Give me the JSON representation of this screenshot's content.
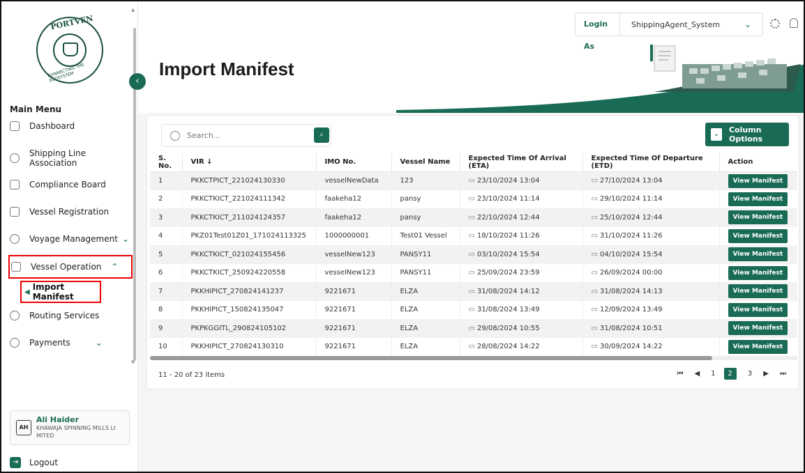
{
  "app": {
    "logo_top": "PORTVEN",
    "logo_bottom": "CONNECTING THE ECOSYSTEM"
  },
  "header": {
    "login_label": "Login As",
    "login_value": "ShippingAgent_System"
  },
  "page": {
    "title": "Import Manifest"
  },
  "sidebar": {
    "menu_title": "Main Menu",
    "items": [
      {
        "label": "Dashboard",
        "icon": "dashboard-icon"
      },
      {
        "label": "Shipping Line Association",
        "icon": "compass-icon"
      },
      {
        "label": "Compliance Board",
        "icon": "document-icon"
      },
      {
        "label": "Vessel Registration",
        "icon": "ship-icon"
      },
      {
        "label": "Voyage Management",
        "icon": "globe-icon",
        "chevron": "⌄"
      },
      {
        "label": "Vessel Operation",
        "icon": "vessel-icon",
        "chevron": "⌃"
      },
      {
        "label": "Routing Services",
        "icon": "route-icon"
      },
      {
        "label": "Payments",
        "icon": "payment-icon",
        "chevron": "⌄"
      }
    ],
    "submenu_active": "Import Manifest",
    "user": {
      "initials": "AH",
      "name": "Ali Haider",
      "org": "KHAWAJA SPINNING MILLS LI MITED"
    },
    "logout": "Logout"
  },
  "toolbar": {
    "search_placeholder": "Search...",
    "column_options": "Column Options"
  },
  "table": {
    "columns": [
      "S. No.",
      "VIR ↓",
      "IMO No.",
      "Vessel Name",
      "Expected Time Of Arrival (ETA)",
      "Expected Time Of Departure (ETD)",
      "Action"
    ],
    "action_label": "View Manifest",
    "rows": [
      {
        "sno": "1",
        "vir": "PKKCTPICT_221024130330",
        "imo": "vesselNewData",
        "vessel": "123",
        "eta": "23/10/2024 13:04",
        "etd": "27/10/2024 13:04"
      },
      {
        "sno": "2",
        "vir": "PKKCTKICT_221024111342",
        "imo": "faakeha12",
        "vessel": "pansy",
        "eta": "23/10/2024 11:14",
        "etd": "29/10/2024 11:14"
      },
      {
        "sno": "3",
        "vir": "PKKCTKICT_211024124357",
        "imo": "faakeha12",
        "vessel": "pansy",
        "eta": "22/10/2024 12:44",
        "etd": "25/10/2024 12:44"
      },
      {
        "sno": "4",
        "vir": "PKZ01Test01Z01_171024113325",
        "imo": "1000000001",
        "vessel": "Test01 Vessel",
        "eta": "18/10/2024 11:26",
        "etd": "31/10/2024 11:26"
      },
      {
        "sno": "5",
        "vir": "PKKCTKICT_021024155456",
        "imo": "vesselNew123",
        "vessel": "PANSY11",
        "eta": "03/10/2024 15:54",
        "etd": "04/10/2024 15:54"
      },
      {
        "sno": "6",
        "vir": "PKKCTKICT_250924220558",
        "imo": "vesselNew123",
        "vessel": "PANSY11",
        "eta": "25/09/2024 23:59",
        "etd": "26/09/2024 00:00"
      },
      {
        "sno": "7",
        "vir": "PKKHIPICT_270824141237",
        "imo": "9221671",
        "vessel": "ELZA",
        "eta": "31/08/2024 14:12",
        "etd": "31/08/2024 14:13"
      },
      {
        "sno": "8",
        "vir": "PKKHIPICT_150824135047",
        "imo": "9221671",
        "vessel": "ELZA",
        "eta": "31/08/2024 13:49",
        "etd": "12/09/2024 13:49"
      },
      {
        "sno": "9",
        "vir": "PKPKGGITL_290824105102",
        "imo": "9221671",
        "vessel": "ELZA",
        "eta": "29/08/2024 10:55",
        "etd": "31/08/2024 10:51"
      },
      {
        "sno": "10",
        "vir": "PKKHIPICT_270824130310",
        "imo": "9221671",
        "vessel": "ELZA",
        "eta": "28/08/2024 14:22",
        "etd": "30/09/2024 14:22"
      }
    ]
  },
  "pagination": {
    "summary": "11 - 20 of 23 items",
    "pages": [
      "1",
      "2",
      "3"
    ],
    "active_page": "2"
  },
  "colors": {
    "brand": "#1a6b55",
    "highlight": "#e00000"
  }
}
